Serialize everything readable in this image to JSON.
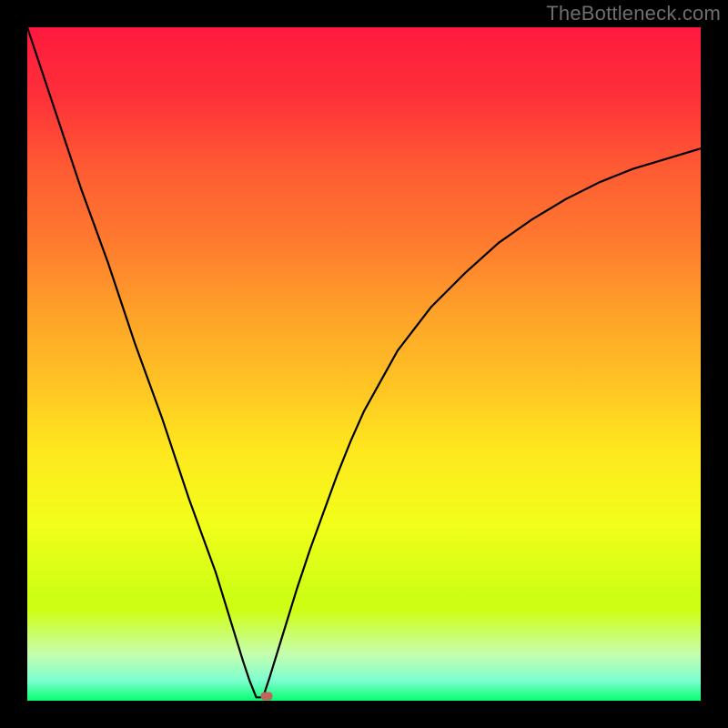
{
  "watermark": "TheBottleneck.com",
  "chart_data": {
    "type": "line",
    "title": "",
    "xlabel": "",
    "ylabel": "",
    "xlim": [
      0,
      100
    ],
    "ylim": [
      0,
      100
    ],
    "x": [
      0,
      2,
      4,
      6,
      8,
      10,
      12,
      14,
      16,
      18,
      20,
      22,
      24,
      26,
      28,
      30,
      32,
      33,
      34,
      35,
      36,
      38,
      40,
      42,
      44,
      46,
      48,
      50,
      55,
      60,
      65,
      70,
      75,
      80,
      85,
      90,
      95,
      100
    ],
    "values": [
      100.0,
      94.0,
      88.0,
      82.0,
      76.0,
      70.5,
      65.0,
      59.0,
      53.0,
      47.5,
      42.0,
      36.0,
      30.0,
      24.5,
      19.0,
      12.5,
      6.0,
      3.0,
      0.5,
      0.5,
      3.5,
      10.0,
      16.5,
      22.5,
      28.0,
      33.5,
      38.5,
      43.0,
      52.0,
      58.5,
      63.5,
      68.0,
      71.5,
      74.5,
      77.0,
      79.0,
      80.5,
      82.0
    ],
    "marker": {
      "x": 35.6,
      "y": 0.7
    },
    "background_gradient": {
      "stops": [
        {
          "pos": 0.0,
          "color": "#fe193e"
        },
        {
          "pos": 0.105,
          "color": "#fe3139"
        },
        {
          "pos": 0.21,
          "color": "#fe5b33"
        },
        {
          "pos": 0.315,
          "color": "#fe792f"
        },
        {
          "pos": 0.42,
          "color": "#fea029"
        },
        {
          "pos": 0.525,
          "color": "#fec224"
        },
        {
          "pos": 0.63,
          "color": "#fee81e"
        },
        {
          "pos": 0.735,
          "color": "#f2fe1a"
        },
        {
          "pos": 0.84,
          "color": "#cffe15"
        },
        {
          "pos": 0.865,
          "color": "#cffe15"
        },
        {
          "pos": 0.93,
          "color": "#c6feae"
        },
        {
          "pos": 0.97,
          "color": "#7efed0"
        },
        {
          "pos": 1.0,
          "color": "#08fe71"
        }
      ]
    }
  }
}
